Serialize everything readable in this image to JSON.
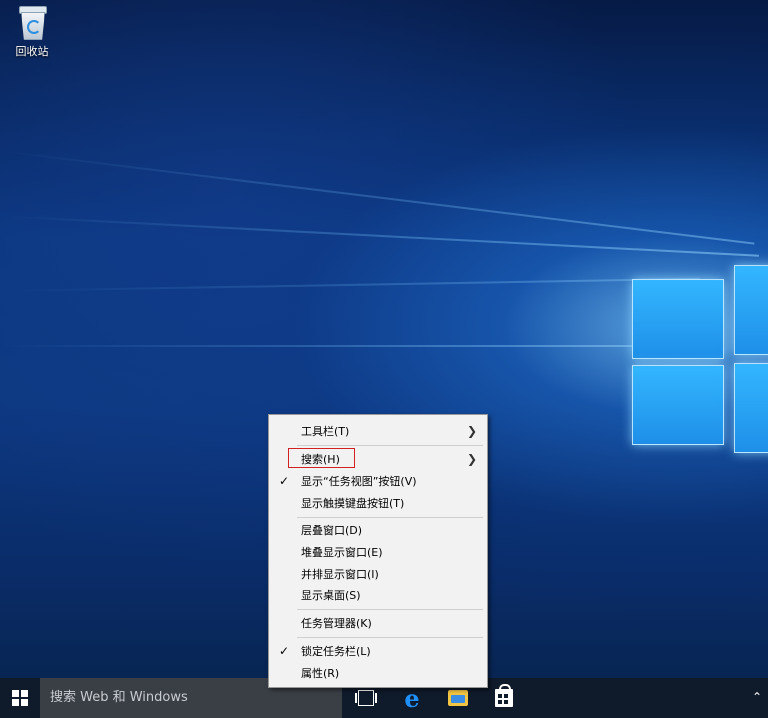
{
  "desktop": {
    "recycle_bin_label": "回收站"
  },
  "taskbar": {
    "search_placeholder": "搜索 Web 和 Windows",
    "icons": [
      "windows-start-icon",
      "task-view-icon",
      "edge-icon",
      "file-explorer-icon",
      "store-icon",
      "chevron-up-icon"
    ]
  },
  "context_menu": {
    "items": [
      {
        "label": "工具栏(T)",
        "submenu": true
      },
      {
        "label": "搜索(H)",
        "submenu": true,
        "highlighted": true
      },
      {
        "label": "显示“任务视图”按钮(V)",
        "checked": true
      },
      {
        "label": "显示触摸键盘按钮(T)"
      },
      {
        "label": "层叠窗口(D)"
      },
      {
        "label": "堆叠显示窗口(E)"
      },
      {
        "label": "并排显示窗口(I)"
      },
      {
        "label": "显示桌面(S)"
      },
      {
        "label": "任务管理器(K)"
      },
      {
        "label": "锁定任务栏(L)",
        "checked": true
      },
      {
        "label": "属性(R)"
      }
    ]
  },
  "colors": {
    "highlight_box": "#d32020",
    "taskbar": "#0f1a2b",
    "search_box": "#3a3f46"
  }
}
